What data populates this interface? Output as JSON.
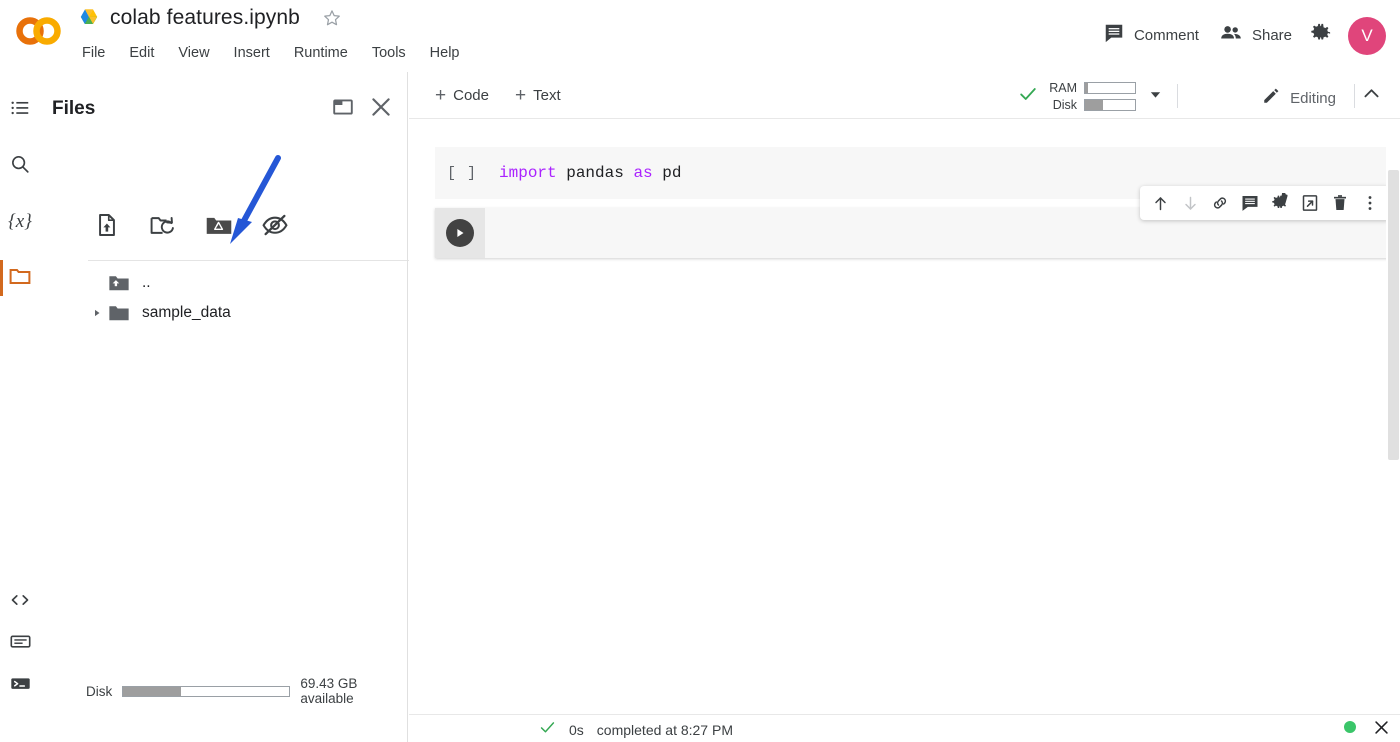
{
  "header": {
    "logo": "colab-logo",
    "drive_icon": "google-drive-icon",
    "notebook_title": "colab features.ipynb",
    "star_icon": "star-outline-icon",
    "menu": [
      {
        "label": "File",
        "name": "menu-file"
      },
      {
        "label": "Edit",
        "name": "menu-edit"
      },
      {
        "label": "View",
        "name": "menu-view"
      },
      {
        "label": "Insert",
        "name": "menu-insert"
      },
      {
        "label": "Runtime",
        "name": "menu-runtime"
      },
      {
        "label": "Tools",
        "name": "menu-tools"
      },
      {
        "label": "Help",
        "name": "menu-help"
      }
    ],
    "comment_label": "Comment",
    "comment_icon": "comment-icon",
    "share_label": "Share",
    "share_icon": "people-icon",
    "settings_icon": "gear-icon",
    "avatar_initial": "V",
    "avatar_color": "#e0457b"
  },
  "rail": {
    "items": [
      {
        "name": "rail-table-of-contents",
        "icon": "list-icon",
        "active": false
      },
      {
        "name": "rail-find-and-replace",
        "icon": "search-icon",
        "active": false
      },
      {
        "name": "rail-variables",
        "icon": "variables-icon",
        "label": "{x}",
        "active": false
      },
      {
        "name": "rail-files",
        "icon": "folder-icon",
        "active": true
      },
      {
        "name": "rail-code-snippets",
        "icon": "code-brackets-icon",
        "active": false
      },
      {
        "name": "rail-command-palette",
        "icon": "keyboard-icon",
        "active": false
      },
      {
        "name": "rail-terminal",
        "icon": "terminal-icon",
        "active": false
      }
    ],
    "active_color": "#d2691e"
  },
  "files_panel": {
    "title": "Files",
    "header_icons": [
      {
        "name": "open-in-new-pane-icon",
        "icon": "new-pane-icon"
      },
      {
        "name": "close-panel-icon",
        "icon": "close-icon"
      }
    ],
    "toolbar": [
      {
        "name": "upload-to-session-storage-button",
        "icon": "upload-file-icon"
      },
      {
        "name": "refresh-button",
        "icon": "folder-refresh-icon"
      },
      {
        "name": "mount-drive-button",
        "icon": "mount-drive-icon"
      },
      {
        "name": "toggle-hidden-files-button",
        "icon": "eye-off-icon"
      }
    ],
    "tree": [
      {
        "name": "parent-directory-row",
        "label": "..",
        "icon": "folder-up-icon",
        "has_caret": false
      },
      {
        "name": "folder-row-sample-data",
        "label": "sample_data",
        "icon": "folder-icon",
        "has_caret": true
      }
    ],
    "disk_label": "Disk",
    "disk_fill_percent": 35,
    "disk_available": "69.43 GB available",
    "annotation_arrow": {
      "name": "blue-annotation-arrow",
      "color": "#2557d6",
      "points_to": "mount-drive-button"
    }
  },
  "notebook_toolbar": {
    "add_code_label": "Code",
    "add_text_label": "Text",
    "plus_glyph": "+",
    "resource_monitor": {
      "status_icon": "green-check-icon",
      "rows": [
        {
          "label": "RAM",
          "fill_percent": 6
        },
        {
          "label": "Disk",
          "fill_percent": 35
        }
      ],
      "dropdown_icon": "caret-down-icon"
    },
    "editing_label": "Editing",
    "editing_icon": "pencil-icon",
    "collapse_icon": "chevron-up-icon"
  },
  "cells": [
    {
      "name": "code-cell-1",
      "prompt": "[ ]",
      "code_tokens": [
        {
          "text": "import",
          "type": "keyword"
        },
        {
          "text": " pandas ",
          "type": "name"
        },
        {
          "text": "as",
          "type": "keyword"
        },
        {
          "text": " pd",
          "type": "name"
        }
      ]
    },
    {
      "name": "code-cell-2",
      "run_button_icon": "play-icon",
      "code": ""
    }
  ],
  "cell_toolbar": [
    {
      "name": "move-cell-up-button",
      "icon": "arrow-up-icon",
      "disabled": false
    },
    {
      "name": "move-cell-down-button",
      "icon": "arrow-down-icon",
      "disabled": true
    },
    {
      "name": "link-to-cell-button",
      "icon": "link-icon",
      "disabled": false
    },
    {
      "name": "add-comment-button",
      "icon": "comment-icon",
      "disabled": false
    },
    {
      "name": "cell-settings-button",
      "icon": "gear-icon",
      "disabled": false
    },
    {
      "name": "mirror-cell-button",
      "icon": "mirror-cell-icon",
      "disabled": false
    },
    {
      "name": "delete-cell-button",
      "icon": "trash-icon",
      "disabled": false
    },
    {
      "name": "more-cell-actions-button",
      "icon": "more-vertical-icon",
      "disabled": false
    }
  ],
  "status_bar": {
    "check_icon": "green-check-icon",
    "duration": "0s",
    "message": "completed at 8:27 PM",
    "connection_icon": "green-dot-icon",
    "close_icon": "close-icon",
    "green": "#3ac569"
  }
}
